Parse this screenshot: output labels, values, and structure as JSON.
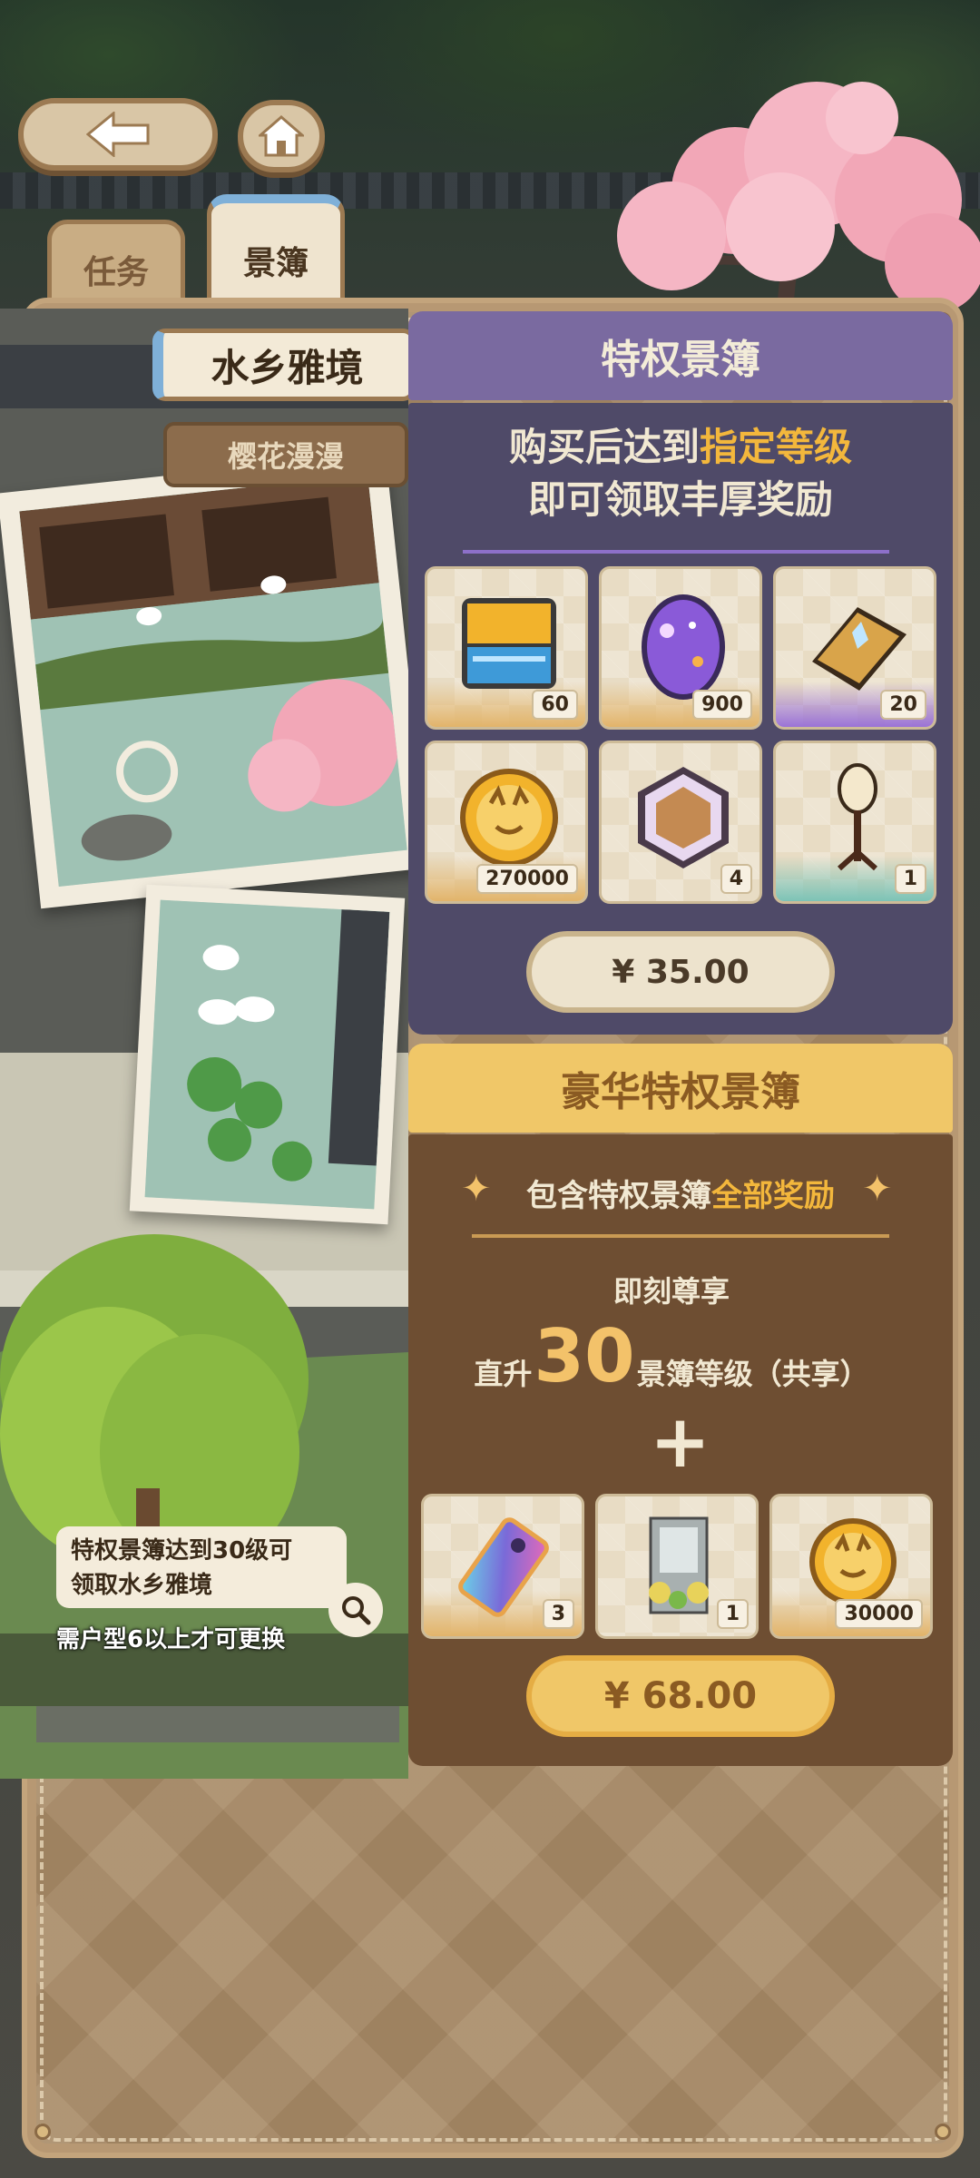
{
  "tabs": {
    "tasks": "任务",
    "scenery_book": "景簿"
  },
  "scenery": {
    "active_name": "水乡雅境",
    "secondary_name": "樱花漫漫",
    "unlock_tip_line1": "特权景簿达到30级可",
    "unlock_tip_line2": "领取水乡雅境",
    "housetype_note": "需户型6以上才可更换"
  },
  "premium_pass": {
    "title": "特权景簿",
    "desc_prefix": "购买后达到",
    "desc_highlight": "指定等级",
    "desc_line2": "即可领取丰厚奖励",
    "rewards": [
      {
        "icon": "ticket-box-icon",
        "qty": "60"
      },
      {
        "icon": "purple-egg-icon",
        "qty": "900"
      },
      {
        "icon": "gold-book-icon",
        "qty": "20"
      },
      {
        "icon": "gold-coin-icon",
        "qty": "270000"
      },
      {
        "icon": "hex-frame-icon",
        "qty": "4"
      },
      {
        "icon": "lamp-post-icon",
        "qty": "1"
      }
    ],
    "price": "¥ 35.00"
  },
  "deluxe_pass": {
    "title": "豪华特权景簿",
    "includes_prefix": "包含特权景簿",
    "includes_highlight": "全部奖励",
    "instant": "即刻尊享",
    "level_prefix": "直升",
    "level_value": "30",
    "level_suffix": "景簿等级（共享）",
    "plus": "+",
    "rewards": [
      {
        "icon": "rainbow-ticket-icon",
        "qty": "3"
      },
      {
        "icon": "flower-gate-icon",
        "qty": "1"
      },
      {
        "icon": "gold-coin-icon",
        "qty": "30000"
      }
    ],
    "price": "¥ 68.00"
  },
  "colors": {
    "premium_header": "#7a6aa0",
    "premium_body": "#4f4a68",
    "deluxe_header": "#f0c768",
    "deluxe_body": "#6e4e32",
    "highlight": "#f3b73c"
  }
}
